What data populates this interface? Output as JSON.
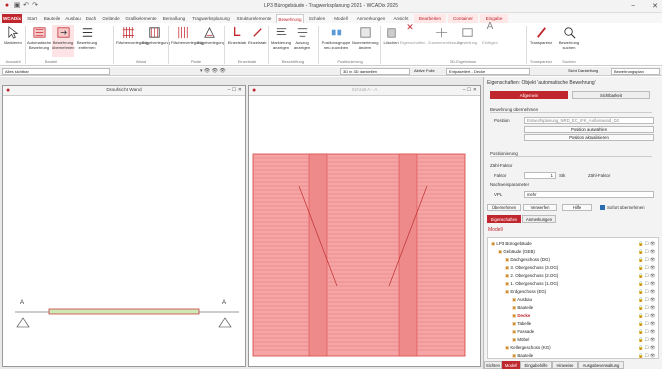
{
  "title": "LP3 Bürogebäude - Tragwerksplanung 2021 - WCADix 2025",
  "window_controls": [
    "−",
    "□",
    "✕"
  ],
  "tabs": [
    "WCADix",
    "Start",
    "Bauteile",
    "Ausbau",
    "Dach",
    "Gelände",
    "Grafikelemente",
    "Bemaßung",
    "Tragwerksplanung",
    "Strukturelemente",
    "Bewehrung",
    "Schalen",
    "Modell",
    "Anmerkungen",
    "Ansicht",
    "Bearbeiten",
    "Container",
    "Eingabe"
  ],
  "ribbon": {
    "buttons": [
      "Markieren",
      "Automatische Bewehrung",
      "Bewehrung übernehmen",
      "Bewehrung entfernen",
      "Flächenverlegung",
      "Bügelverlegung",
      "Flächenverlegung",
      "Bügelverlegung",
      "Einzelstab",
      "Einzelstab",
      "Markierung anzeigen",
      "Auszug anzeigen",
      "Positionsgruppe neu zuordnen",
      "Nummerierung ändern",
      "Löschen",
      "Eigenschaften",
      "Zusammenfassung",
      "Darstellung",
      "Einfügen",
      "Transparenz",
      "Bewehrung suchen"
    ],
    "groups": [
      "Auswahl",
      "Bauteil",
      "Wand",
      "Platte",
      "Einzelstab",
      "Beschriftung",
      "Positionierung",
      "3D-Ergebnisse",
      "Transparenz",
      "Suchen"
    ]
  },
  "ctx": {
    "view": "Alles sichtbar",
    "mid": "",
    "layer": "3D in 3D darstellen",
    "active": "Aktive Folie",
    "folie": "Entpaketiert - Decke",
    "sicht": "Sicht Darstellung",
    "sicht_val": "Bewehrungsplan"
  },
  "left_pane": {
    "title": "Draufsicht Wand",
    "axis_label": "A"
  },
  "mid_pane": {
    "title": "Schnitt A - A"
  },
  "colors": {
    "brand": "#c0262d",
    "rebar_fill": "#f28b8b",
    "rebar_line": "#e04848"
  },
  "props": {
    "header": "Eigenschaften: Objekt 'automatische Bewehrung'",
    "tab1": "Allgemein",
    "tab2": "Sichtbarkeit",
    "sec1": "Bewehrung übernehmen",
    "pos_label": "Position",
    "pos_value": "Entwurfsplanung_NRD_EC_IFK_Außenwand_D2",
    "btn1": "Position auswählen",
    "btn2": "Position aktualisieren",
    "sec2": "Positionierung",
    "sec3": "Zähl-Faktor",
    "factor_label": "Faktor",
    "factor_value": "1",
    "factor_unit": "Stk",
    "factor_extra": "Zähl-Faktor",
    "sec4": "Nachweisparameter",
    "vpl_label": "VPL",
    "vpl_value": "mehr",
    "actions": [
      "Übernehmen",
      "Verwerfen",
      "Hilfe",
      "Sofort übernehmen"
    ],
    "subtabs": [
      "Eigenschaften",
      "Anmerkungen"
    ],
    "model_title": "Modell",
    "tree": [
      "LP3 Bürogebäude",
      "Gebäude (GEB)",
      "Dachgeschoss (DG)",
      "3. Obergeschoss (3.OG)",
      "2. Obergeschoss (2.OG)",
      "1. Obergeschoss (1.OG)",
      "Erdgeschoss (EG)",
      "Ausbau",
      "Bauteile",
      "Decke",
      "Tabelle",
      "Fassade",
      "Möbel",
      "Kellergeschoss (KG)",
      "Bauteile"
    ],
    "bottom_tabs": [
      "Sichten",
      "Modell",
      "Eingabehilfe",
      "Hinweise",
      "Ausgabeverwaltung"
    ]
  }
}
